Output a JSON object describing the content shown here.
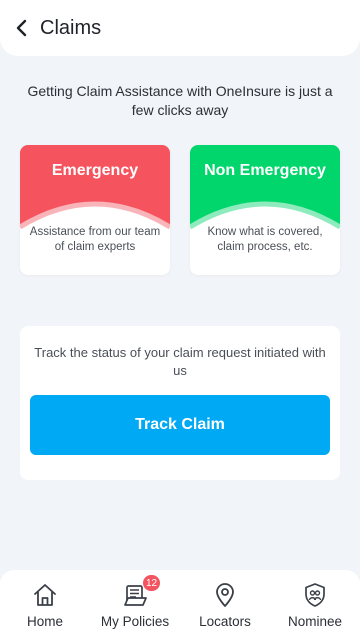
{
  "header": {
    "title": "Claims",
    "back_icon": "chevron-left-icon"
  },
  "intro": {
    "text": "Getting Claim Assistance with OneInsure is just a few clicks away"
  },
  "cards": [
    {
      "title": "Emergency",
      "description": "Assistance from our team of claim experts",
      "color": "#f5535e"
    },
    {
      "title": "Non Emergency",
      "description": "Know what is covered, claim process, etc.",
      "color": "#00d66b"
    }
  ],
  "track": {
    "text": "Track the status of your claim request initiated with us",
    "button_label": "Track Claim",
    "button_color": "#00a9f4"
  },
  "nav": {
    "items": [
      {
        "label": "Home",
        "icon": "home-icon"
      },
      {
        "label": "My Policies",
        "icon": "policies-icon",
        "badge": "12"
      },
      {
        "label": "Locators",
        "icon": "location-pin-icon"
      },
      {
        "label": "Nominee",
        "icon": "nominee-shield-icon"
      }
    ]
  }
}
